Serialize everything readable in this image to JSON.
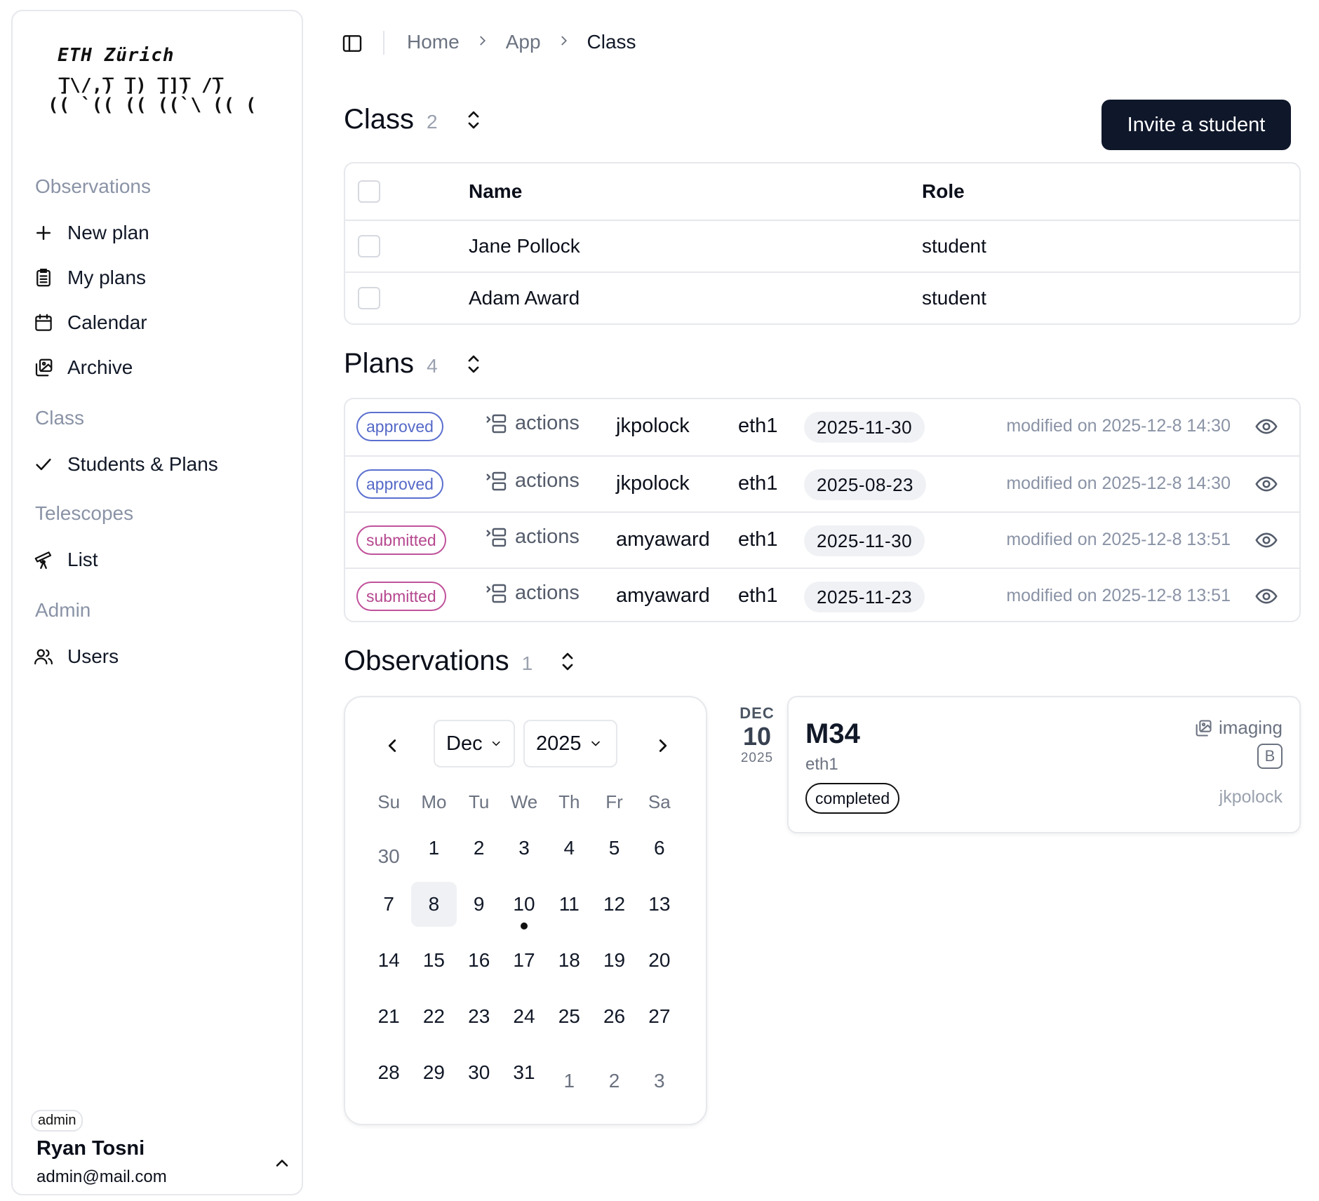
{
  "sidebar": {
    "logo_title": "ETH Zürich",
    "logo_art": " ̅]\\/,̅) ̅]) ̅]]̅) /̅)\n(( `(( (( ((`\\ (( (",
    "sections": [
      {
        "label": "Observations"
      },
      {
        "label": "Class"
      },
      {
        "label": "Telescopes"
      },
      {
        "label": "Admin"
      }
    ],
    "items": {
      "new_plan": "New plan",
      "my_plans": "My plans",
      "calendar": "Calendar",
      "archive": "Archive",
      "students_plans": "Students & Plans",
      "list": "List",
      "users": "Users"
    },
    "user": {
      "role": "admin",
      "name": "Ryan Tosni",
      "email": "admin@mail.com"
    }
  },
  "breadcrumb": [
    "Home",
    "App",
    "Class"
  ],
  "class_section": {
    "title": "Class",
    "count": "2",
    "invite_label": "Invite a student",
    "columns": {
      "name": "Name",
      "role": "Role"
    },
    "rows": [
      {
        "name": "Jane Pollock",
        "role": "student"
      },
      {
        "name": "Adam Award",
        "role": "student"
      }
    ]
  },
  "plans_section": {
    "title": "Plans",
    "count": "4",
    "rows": [
      {
        "status": "approved",
        "actions": "actions",
        "user": "jkpolock",
        "telescope": "eth1",
        "date": "2025-11-30",
        "modified": "modified on 2025-12-8 14:30"
      },
      {
        "status": "approved",
        "actions": "actions",
        "user": "jkpolock",
        "telescope": "eth1",
        "date": "2025-08-23",
        "modified": "modified on 2025-12-8 14:30"
      },
      {
        "status": "submitted",
        "actions": "actions",
        "user": "amyaward",
        "telescope": "eth1",
        "date": "2025-11-30",
        "modified": "modified on 2025-12-8 13:51"
      },
      {
        "status": "submitted",
        "actions": "actions",
        "user": "amyaward",
        "telescope": "eth1",
        "date": "2025-11-23",
        "modified": "modified on 2025-12-8 13:51"
      }
    ]
  },
  "observations_section": {
    "title": "Observations",
    "count": "1",
    "calendar": {
      "month": "Dec",
      "year": "2025",
      "weekdays": [
        "Su",
        "Mo",
        "Tu",
        "We",
        "Th",
        "Fr",
        "Sa"
      ],
      "weeks": [
        [
          "30",
          "1",
          "2",
          "3",
          "4",
          "5",
          "6"
        ],
        [
          "7",
          "8",
          "9",
          "10",
          "11",
          "12",
          "13"
        ],
        [
          "14",
          "15",
          "16",
          "17",
          "18",
          "19",
          "20"
        ],
        [
          "21",
          "22",
          "23",
          "24",
          "25",
          "26",
          "27"
        ],
        [
          "28",
          "29",
          "30",
          "31",
          "1",
          "2",
          "3"
        ]
      ]
    },
    "item": {
      "date_month": "DEC",
      "date_day": "10",
      "date_year": "2025",
      "title": "M34",
      "telescope": "eth1",
      "status": "completed",
      "type": "imaging",
      "badge": "B",
      "user": "jkpolock"
    }
  }
}
